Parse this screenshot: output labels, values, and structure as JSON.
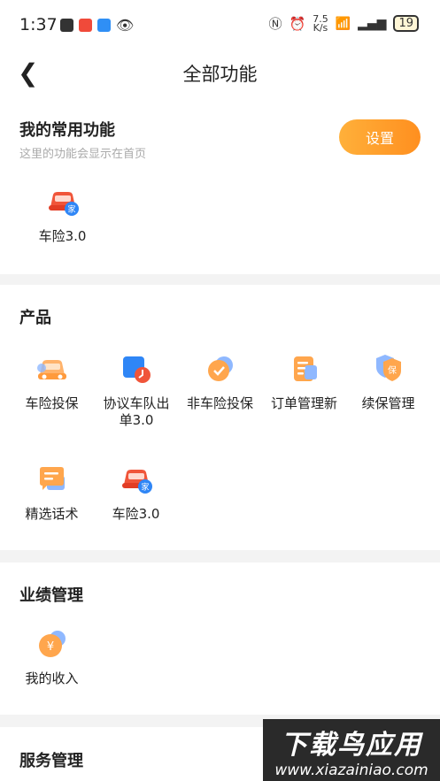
{
  "status_bar": {
    "time": "1:37",
    "speed_top": "7.5",
    "speed_bottom": "K/s",
    "battery": "19"
  },
  "header": {
    "title": "全部功能"
  },
  "favorites": {
    "title": "我的常用功能",
    "subtitle": "这里的功能会显示在首页",
    "settings_label": "设置",
    "items": [
      {
        "label": "车险3.0",
        "icon": "car-insurance-icon"
      }
    ]
  },
  "products": {
    "title": "产品",
    "items": [
      {
        "label": "车险投保",
        "icon": "car-icon"
      },
      {
        "label": "协议车队出单3.0",
        "icon": "fleet-clock-icon"
      },
      {
        "label": "非车险投保",
        "icon": "shield-check-icon"
      },
      {
        "label": "订单管理新",
        "icon": "order-list-icon"
      },
      {
        "label": "续保管理",
        "icon": "renewal-shield-icon"
      },
      {
        "label": "精选话术",
        "icon": "chat-script-icon"
      },
      {
        "label": "车险3.0",
        "icon": "car-insurance-icon"
      }
    ]
  },
  "performance": {
    "title": "业绩管理",
    "items": [
      {
        "label": "我的收入",
        "icon": "income-coin-icon"
      }
    ]
  },
  "services": {
    "title": "服务管理"
  },
  "icon_text": {
    "home_badge": "家",
    "renewal_badge": "保",
    "yuan": "¥"
  },
  "watermark": {
    "text": "下载鸟应用",
    "url": "www.xiazainiao.com"
  },
  "colors": {
    "accent_orange": "#ff8f1f",
    "car_red": "#f0553a",
    "badge_blue": "#2f86f6"
  }
}
